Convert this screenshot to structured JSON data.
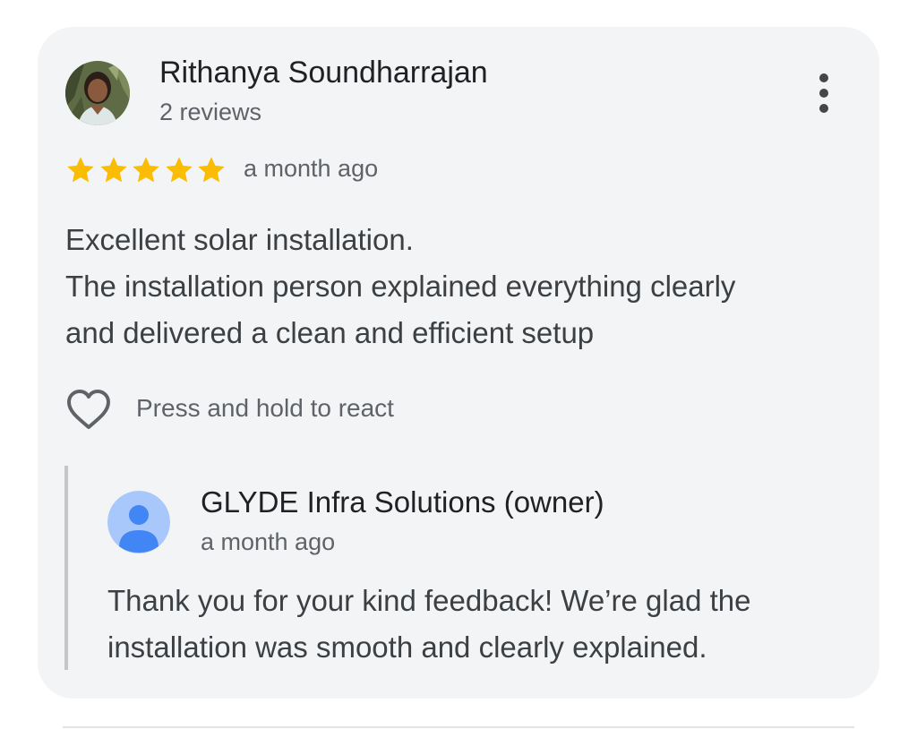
{
  "review": {
    "reviewer_name": "Rithanya Soundharrajan",
    "review_count": "2 reviews",
    "rating": 5,
    "rating_max": 5,
    "time": "a month ago",
    "text_lines": [
      "Excellent solar installation.",
      "The installation person explained everything clearly",
      "and delivered a clean and efficient setup"
    ],
    "react_label": "Press and hold to react",
    "icons": {
      "more": "more-vert-icon",
      "star": "star-icon",
      "heart": "heart-outline-icon",
      "owner_avatar": "person-icon"
    }
  },
  "owner_reply": {
    "name": "GLYDE Infra Solutions (owner)",
    "time": "a month ago",
    "text_lines": [
      "Thank you for your kind feedback! We’re glad the",
      "installation was smooth and clearly explained."
    ]
  },
  "colors": {
    "card_background": "#f3f4f6",
    "star": "#fbbc04",
    "owner_avatar_bg": "#a8c7fa",
    "owner_avatar_fg": "#4285f4",
    "reply_rule": "#c4c7c5"
  }
}
